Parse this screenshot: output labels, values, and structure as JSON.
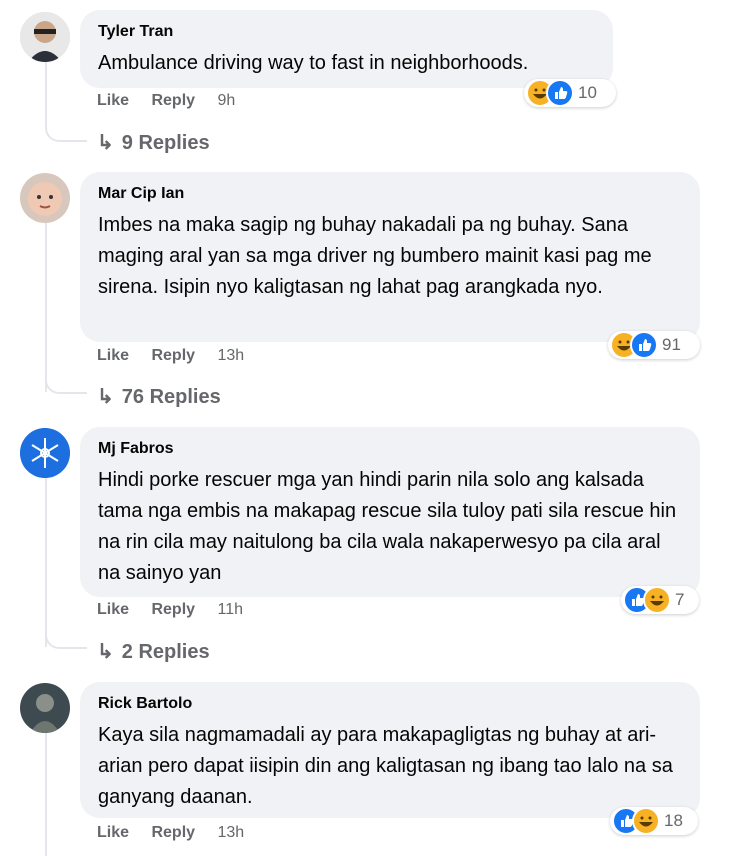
{
  "comments": [
    {
      "author": "Tyler Tran",
      "text": "Ambulance driving way to fast in neighborhoods.",
      "like_label": "Like",
      "reply_label": "Reply",
      "time": "9h",
      "reactions": [
        "haha-icon",
        "like-icon"
      ],
      "reaction_count": "10",
      "replies_label": "9 Replies"
    },
    {
      "author": "Mar Cip Ian",
      "text": "Imbes na maka sagip ng buhay nakadali pa ng buhay. Sana maging aral yan sa mga driver ng bumbero mainit kasi pag me sirena. Isipin nyo kaligtasan ng lahat pag arangkada nyo.",
      "like_label": "Like",
      "reply_label": "Reply",
      "time": "13h",
      "reactions": [
        "haha-icon",
        "like-icon"
      ],
      "reaction_count": "91",
      "replies_label": "76 Replies"
    },
    {
      "author": "Mj Fabros",
      "text": "Hindi porke rescuer mga yan hindi parin nila solo ang kalsada tama nga embis na makapag rescue sila tuloy pati sila rescue hin na rin cila may naitulong ba cila wala nakaperwesyo pa cila aral na sainyo yan",
      "like_label": "Like",
      "reply_label": "Reply",
      "time": "11h",
      "reactions": [
        "like-icon",
        "haha-icon"
      ],
      "reaction_count": "7",
      "replies_label": "2 Replies"
    },
    {
      "author": "Rick Bartolo",
      "text": "Kaya sila nagmamadali ay para makapagligtas ng buhay at ari-arian pero dapat iisipin din ang kaligtasan ng ibang tao lalo na sa ganyang daanan.",
      "like_label": "Like",
      "reply_label": "Reply",
      "time": "13h",
      "reactions": [
        "like-icon",
        "haha-icon"
      ],
      "reaction_count": "18"
    }
  ],
  "colors": {
    "bubble": "#f0f2f5",
    "meta": "#65676b",
    "like_blue": "#1877f2",
    "haha_yellow": "#f7b125"
  }
}
